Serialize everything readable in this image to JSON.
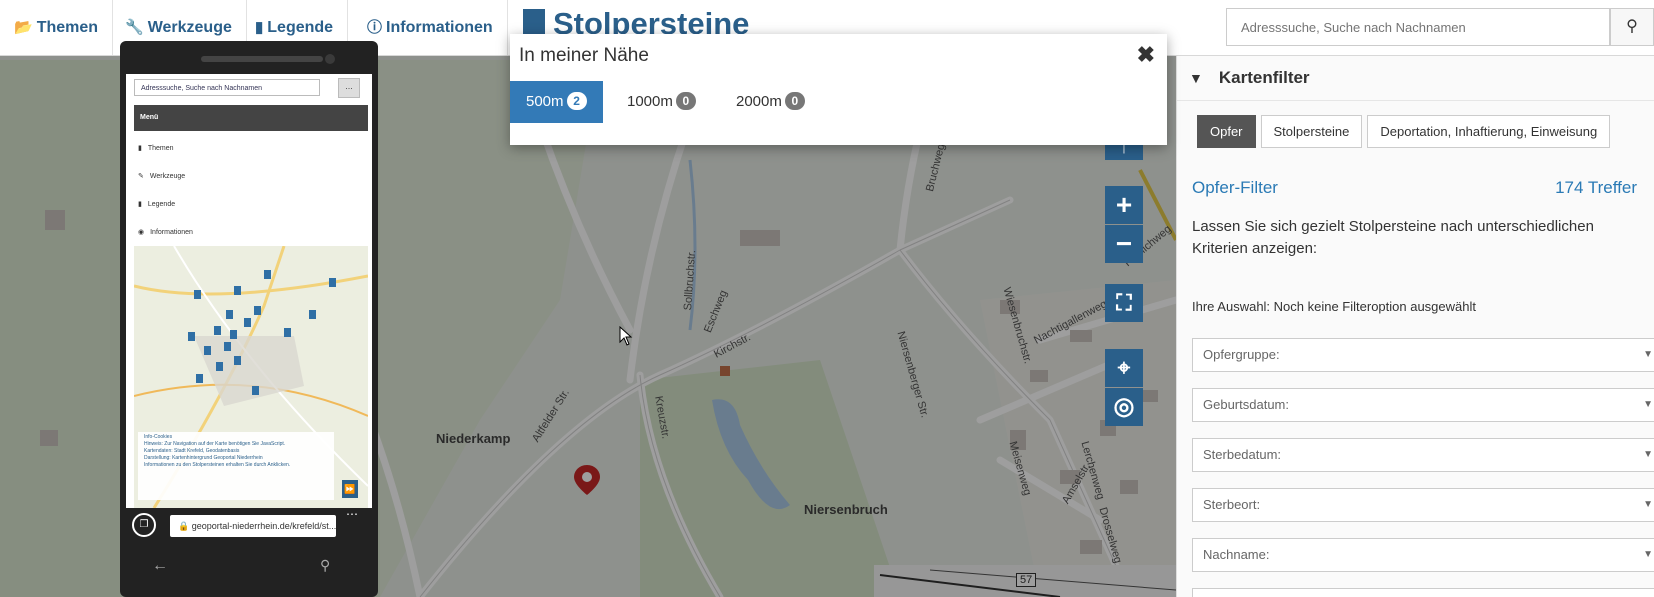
{
  "nav": {
    "items": [
      {
        "icon": "folder-icon",
        "glyph": "📂",
        "label": "Themen"
      },
      {
        "icon": "wrench-icon",
        "glyph": "🔧",
        "label": "Werkzeuge"
      },
      {
        "icon": "book-icon",
        "glyph": "▮",
        "label": "Legende"
      },
      {
        "icon": "info-icon",
        "glyph": "ⓘ",
        "label": "Informationen"
      }
    ],
    "title": "Stolpersteine",
    "search_placeholder": "Adresssuche, Suche nach Nachnamen"
  },
  "modal": {
    "title": "In meiner Nähe",
    "tabs": [
      {
        "label": "500m",
        "count": "2",
        "active": true
      },
      {
        "label": "1000m",
        "count": "0",
        "active": false
      },
      {
        "label": "2000m",
        "count": "0",
        "active": false
      }
    ]
  },
  "panel": {
    "title": "Kartenfilter",
    "tabs": [
      "Opfer",
      "Stolpersteine",
      "Deportation, Inhaftierung, Einweisung"
    ],
    "filter_title": "Opfer-Filter",
    "hits": "174 Treffer",
    "description": "Lassen Sie sich gezielt Stolpersteine nach unterschiedlichen Kriterien anzeigen:",
    "selection": "Ihre Auswahl: Noch keine Filteroption ausgewählt",
    "fields": [
      "Opfergruppe:",
      "Geburtsdatum:",
      "Sterbedatum:",
      "Sterbeort:",
      "Nachname:"
    ]
  },
  "map": {
    "labels": [
      "Niederkamp",
      "Niersenbruch",
      "Altfelder Str.",
      "Kreuzstr.",
      "Kirchstr.",
      "Eschweg",
      "Nachtigallenweg",
      "Niersenberger Str.",
      "Wiesenbruchstr.",
      "Lerchenweg",
      "Amselstr.",
      "Drosselweg",
      "Meisenweg",
      "Kranichweg",
      "Bruchweg",
      "Sollbruchstr."
    ],
    "road_shield": "57"
  },
  "phone": {
    "search_text": "Adresssuche, Suche nach Nachnamen",
    "menu_label": "Menü",
    "items": [
      "Themen",
      "Werkzeuge",
      "Legende",
      "Informationen"
    ],
    "url": "geoportal-niederrhein.de/krefeld/st...",
    "info_lines": [
      "Info-Cookies",
      "Hinweis: Zur Navigation auf der Karte benötigen Sie JavaScript.",
      "Kartendaten: Stadt Krefeld, Geodatenbasis",
      "Darstellung: Kartenhintergrund Geoportal Niederrhein",
      "Informationen zu den Stolpersteinen erhalten Sie durch Anklicken."
    ]
  },
  "colors": {
    "accent": "#337ab7",
    "brand": "#2a5f8a",
    "pin": "#c62828"
  }
}
